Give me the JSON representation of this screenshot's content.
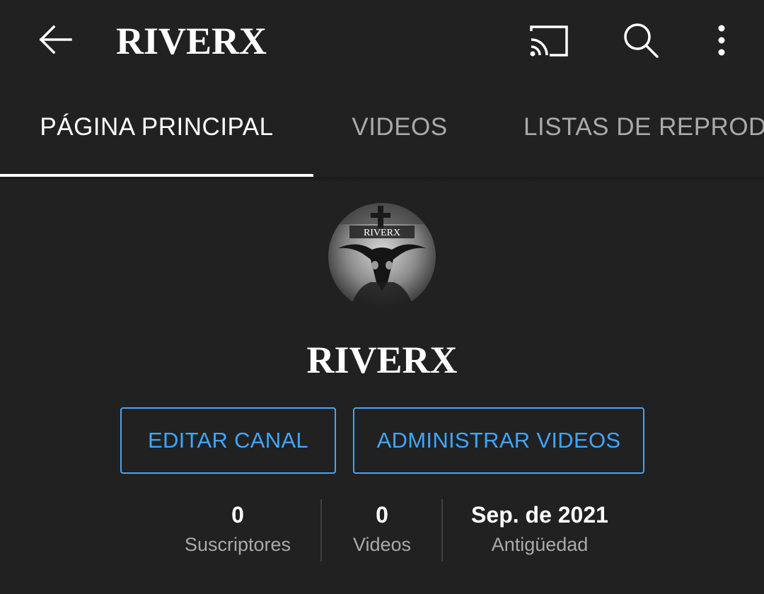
{
  "app_bar": {
    "title": "RIVERX",
    "icons": [
      "back-arrow-icon",
      "cast-icon",
      "search-icon",
      "more-vert-icon"
    ]
  },
  "tabs": [
    {
      "label": "PÁGINA PRINCIPAL",
      "selected": true
    },
    {
      "label": "VIDEOS",
      "selected": false
    },
    {
      "label": "LISTAS DE REPRODUCCIÓN",
      "selected": false
    }
  ],
  "channel": {
    "avatar_text": "RIVERX",
    "name": "RIVERX"
  },
  "actions": {
    "edit_label": "EDITAR CANAL",
    "manage_label": "ADMINISTRAR VIDEOS"
  },
  "stats": {
    "subscribers": {
      "value": "0",
      "label": "Suscriptores"
    },
    "videos": {
      "value": "0",
      "label": "Videos"
    },
    "since": {
      "value": "Sep. de 2021",
      "label": "Antigüedad"
    }
  },
  "colors": {
    "background": "#212121",
    "accent_blue": "#3ea6ff",
    "secondary_text": "#aaaaaa",
    "primary_text": "#ffffff"
  }
}
